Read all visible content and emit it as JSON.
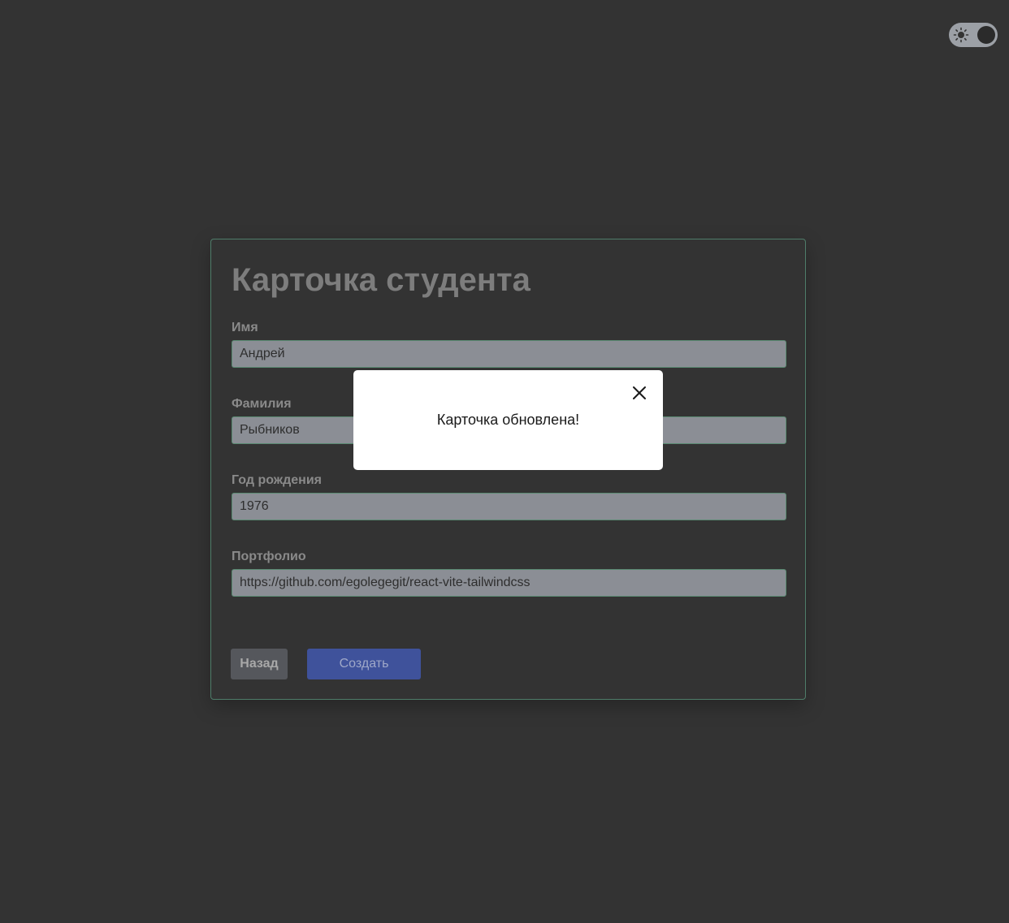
{
  "theme_toggle": {
    "icon": "sun-icon",
    "state": "dark"
  },
  "card": {
    "title": "Карточка студента",
    "fields": [
      {
        "label": "Имя",
        "value": "Андрей"
      },
      {
        "label": "Фамилия",
        "value": "Рыбников"
      },
      {
        "label": "Год рождения",
        "value": "1976"
      },
      {
        "label": "Портфолио",
        "value": "https://github.com/egolegegit/react-vite-tailwindcss"
      }
    ],
    "back_label": "Назад",
    "create_label": "Создать"
  },
  "modal": {
    "message": "Карточка обновлена!",
    "close_icon": "close-icon"
  },
  "colors": {
    "background": "#333333",
    "card_border": "#4f7d6a",
    "input_bg": "#8b8e95",
    "primary_button": "#3f529b",
    "secondary_button": "#55575c"
  }
}
